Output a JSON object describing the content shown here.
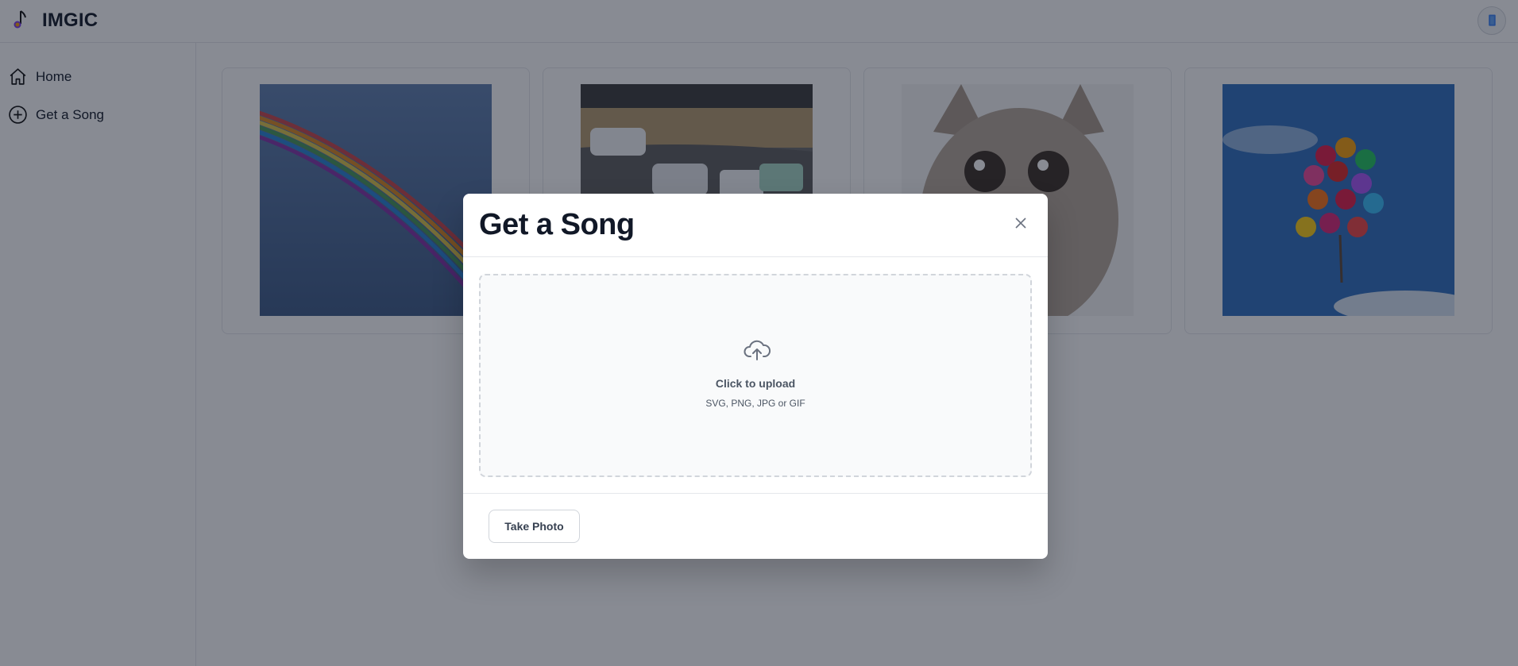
{
  "app": {
    "brand": "IMGIC"
  },
  "header": {
    "avatar_icon": "user-avatar-icon"
  },
  "sidebar": {
    "items": [
      {
        "label": "Home",
        "icon": "home-icon"
      },
      {
        "label": "Get a Song",
        "icon": "plus-circle-icon"
      }
    ]
  },
  "gallery": {
    "items": [
      {
        "subject": "rainbow"
      },
      {
        "subject": "race-cars"
      },
      {
        "subject": "cat"
      },
      {
        "subject": "balloons"
      }
    ]
  },
  "modal": {
    "title": "Get a Song",
    "close_icon": "close-icon",
    "upload": {
      "icon": "cloud-upload-icon",
      "title": "Click to upload",
      "subtitle": "SVG, PNG, JPG or GIF"
    },
    "footer": {
      "take_photo_label": "Take Photo"
    }
  },
  "colors": {
    "overlay": "#111827",
    "text": "#111827",
    "border": "#e5e7eb",
    "muted": "#4b5563"
  }
}
